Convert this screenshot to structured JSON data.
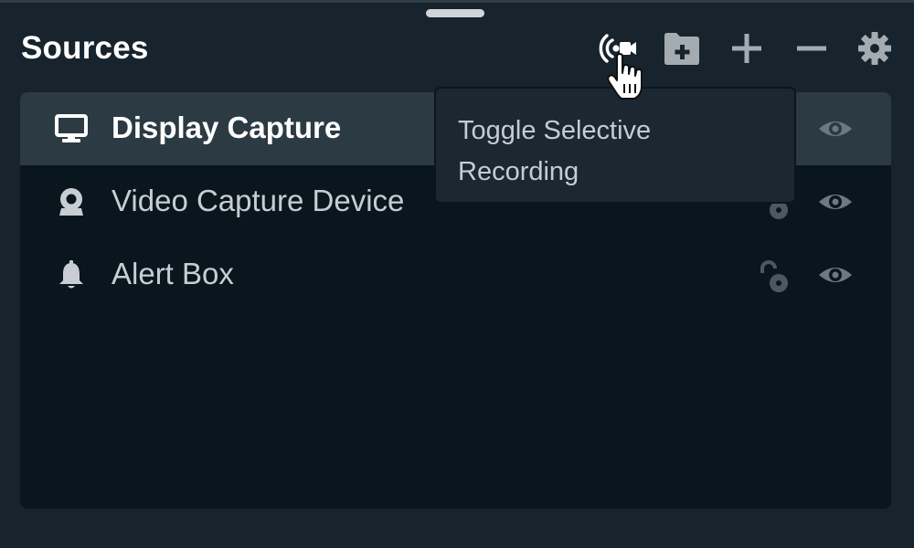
{
  "panel": {
    "title": "Sources"
  },
  "toolbar": {
    "buttons": [
      {
        "name": "toggle-selective-recording",
        "icon": "broadcast-camera-icon"
      },
      {
        "name": "add-folder",
        "icon": "folder-plus-icon"
      },
      {
        "name": "add-source",
        "icon": "plus-icon"
      },
      {
        "name": "remove-source",
        "icon": "minus-icon"
      },
      {
        "name": "source-settings",
        "icon": "gear-icon"
      }
    ]
  },
  "tooltip": {
    "line1": "Toggle Selective",
    "line2": "Recording"
  },
  "sources": [
    {
      "name": "Display Capture",
      "icon": "monitor-icon",
      "selected": true,
      "locked": false,
      "visible": true
    },
    {
      "name": "Video Capture Device",
      "icon": "webcam-icon",
      "selected": false,
      "locked": false,
      "visible": true
    },
    {
      "name": "Alert Box",
      "icon": "bell-icon",
      "selected": false,
      "locked": false,
      "visible": true
    }
  ],
  "colors": {
    "panel_bg": "#17242d",
    "list_bg": "#09161e",
    "selected_row_bg": "#2c3a44",
    "icon_gray": "#6d7880",
    "text_light": "#c7cdd2",
    "white": "#ffffff"
  }
}
